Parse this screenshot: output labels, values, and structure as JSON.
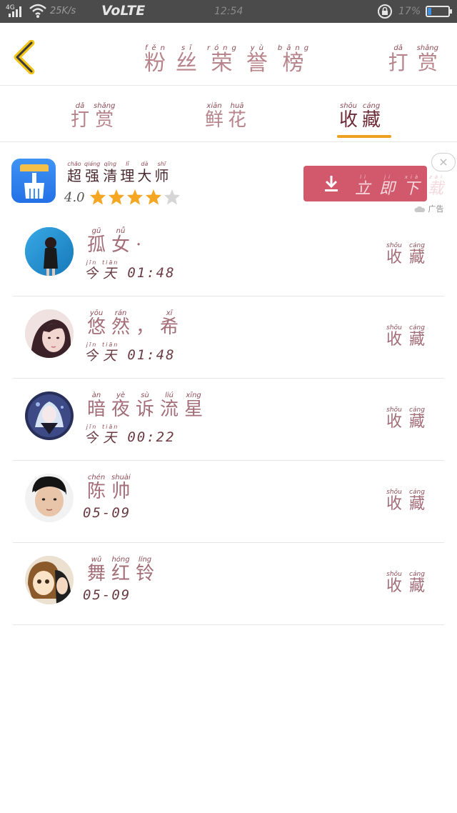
{
  "status_bar": {
    "network": "4G",
    "speed": "25K/s",
    "carrier_tag": "VoLTE",
    "time": "12:54",
    "battery_pct": "17%",
    "battery_level": 0.17
  },
  "header": {
    "back_icon": "chevron-left-icon",
    "title": [
      {
        "py": "fěn",
        "hz": "粉"
      },
      {
        "py": "sī",
        "hz": "丝"
      },
      {
        "py": "róng",
        "hz": "荣"
      },
      {
        "py": "yù",
        "hz": "誉"
      },
      {
        "py": "bǎng",
        "hz": "榜"
      }
    ],
    "reward": [
      {
        "py": "dǎ",
        "hz": "打"
      },
      {
        "py": "shǎng",
        "hz": "赏"
      }
    ]
  },
  "tabs": [
    {
      "id": "reward",
      "active": false,
      "chars": [
        {
          "py": "dǎ",
          "hz": "打"
        },
        {
          "py": "shǎng",
          "hz": "赏"
        }
      ]
    },
    {
      "id": "flowers",
      "active": false,
      "chars": [
        {
          "py": "xiān",
          "hz": "鲜"
        },
        {
          "py": "huā",
          "hz": "花"
        }
      ]
    },
    {
      "id": "favorites",
      "active": true,
      "chars": [
        {
          "py": "shōu",
          "hz": "收"
        },
        {
          "py": "cáng",
          "hz": "藏"
        }
      ]
    }
  ],
  "ad": {
    "name": [
      {
        "py": "chāo",
        "hz": "超"
      },
      {
        "py": "qiáng",
        "hz": "强"
      },
      {
        "py": "qīng",
        "hz": "清"
      },
      {
        "py": "lǐ",
        "hz": "理"
      },
      {
        "py": "dà",
        "hz": "大"
      },
      {
        "py": "shī",
        "hz": "师"
      }
    ],
    "rating": "4.0",
    "stars_filled": 4,
    "stars_total": 5,
    "download": [
      {
        "py": "lì",
        "hz": "立"
      },
      {
        "py": "jí",
        "hz": "即"
      },
      {
        "py": "xià",
        "hz": "下"
      },
      {
        "py": "zài",
        "hz": "载"
      }
    ],
    "close_label": "×",
    "tag": "广告",
    "star_color": "#f5a623",
    "button_color": "#d2586c"
  },
  "favorite_label": [
    {
      "py": "shōu",
      "hz": "收"
    },
    {
      "py": "cáng",
      "hz": "藏"
    }
  ],
  "rows": [
    {
      "nick": [
        {
          "py": "gū",
          "hz": "孤"
        },
        {
          "py": "nǚ",
          "hz": "女"
        },
        {
          "py": "",
          "hz": "·"
        }
      ],
      "date": [
        {
          "py": "jīn",
          "hz": "今"
        },
        {
          "py": "tiān",
          "hz": "天"
        }
      ],
      "time": "01:48",
      "avatar": "avatar-girl-blue"
    },
    {
      "nick": [
        {
          "py": "yōu",
          "hz": "悠"
        },
        {
          "py": "rán",
          "hz": "然"
        },
        {
          "py": "",
          "hz": "，"
        },
        {
          "py": "xī",
          "hz": "希"
        }
      ],
      "date": [
        {
          "py": "jīn",
          "hz": "今"
        },
        {
          "py": "tiān",
          "hz": "天"
        }
      ],
      "time": "01:48",
      "avatar": "avatar-girl-pink"
    },
    {
      "nick": [
        {
          "py": "àn",
          "hz": "暗"
        },
        {
          "py": "yè",
          "hz": "夜"
        },
        {
          "py": "sù",
          "hz": "诉"
        },
        {
          "py": "liú",
          "hz": "流"
        },
        {
          "py": "xīng",
          "hz": "星"
        }
      ],
      "date": [
        {
          "py": "jīn",
          "hz": "今"
        },
        {
          "py": "tiān",
          "hz": "天"
        }
      ],
      "time": "00:22",
      "avatar": "avatar-anime"
    },
    {
      "nick": [
        {
          "py": "chén",
          "hz": "陈"
        },
        {
          "py": "shuài",
          "hz": "帅"
        }
      ],
      "date": [],
      "time": "05-09",
      "avatar": "avatar-boy"
    },
    {
      "nick": [
        {
          "py": "wǔ",
          "hz": "舞"
        },
        {
          "py": "hóng",
          "hz": "红"
        },
        {
          "py": "líng",
          "hz": "铃"
        }
      ],
      "date": [],
      "time": "05-09",
      "avatar": "avatar-cartoon"
    }
  ]
}
